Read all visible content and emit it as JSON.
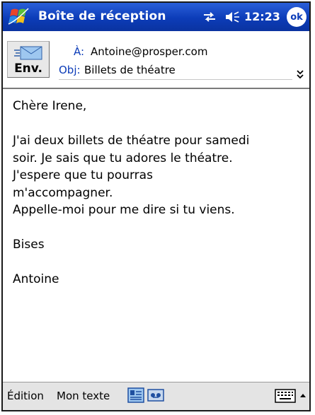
{
  "titlebar": {
    "title": "Boîte de réception",
    "clock": "12:23",
    "ok_label": "ok"
  },
  "header": {
    "send_label": "Env.",
    "to_label": "À:",
    "to_value": "Antoine@prosper.com",
    "subject_label": "Obj:",
    "subject_value": "Billets de théatre"
  },
  "body": {
    "lines": [
      "Chère Irene,",
      "",
      "J'ai deux billets de théatre pour samedi",
      "soir. Je sais que tu adores le théatre.",
      "J'espere que tu pourras",
      "m'accompagner.",
      "Appelle-moi pour me dire si tu viens.",
      "",
      "Bises",
      "",
      "Antoine"
    ]
  },
  "menubar": {
    "edit_label": "Édition",
    "mytext_label": "Mon texte"
  },
  "colors": {
    "titlebar": "#0c3cb8",
    "field_label": "#0c3cb8"
  }
}
